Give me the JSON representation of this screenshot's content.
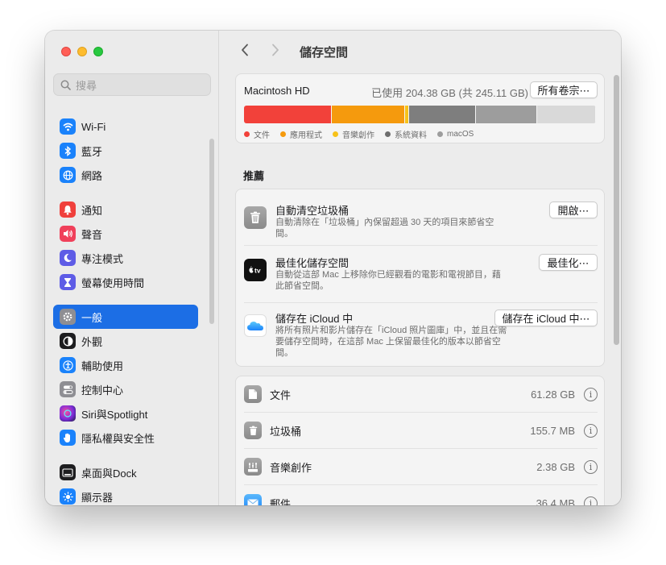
{
  "window": {
    "title": "儲存空間"
  },
  "search": {
    "placeholder": "搜尋"
  },
  "sidebar": {
    "items": [
      {
        "label": "Wi-Fi",
        "icon": "wifi-icon",
        "color": "#1a82fb"
      },
      {
        "label": "藍牙",
        "icon": "bluetooth-icon",
        "color": "#1a82fb"
      },
      {
        "label": "網路",
        "icon": "globe-icon",
        "color": "#1a82fb"
      },
      {
        "label": "通知",
        "icon": "bell-icon",
        "color": "#f0403c"
      },
      {
        "label": "聲音",
        "icon": "speaker-icon",
        "color": "#f0405a"
      },
      {
        "label": "專注模式",
        "icon": "moon-icon",
        "color": "#5e5ce6"
      },
      {
        "label": "螢幕使用時間",
        "icon": "hourglass-icon",
        "color": "#5e5ce6"
      },
      {
        "label": "一般",
        "icon": "gear-icon",
        "color": "#8e8e93",
        "selected": true
      },
      {
        "label": "外觀",
        "icon": "appearance-icon",
        "color": "#1d1d1f"
      },
      {
        "label": "輔助使用",
        "icon": "accessibility-icon",
        "color": "#1a82fb"
      },
      {
        "label": "控制中心",
        "icon": "toggles-icon",
        "color": "#8e8e93"
      },
      {
        "label": "Siri與Spotlight",
        "icon": "siri-icon",
        "color": "#8b3ad6"
      },
      {
        "label": "隱私權與安全性",
        "icon": "hand-icon",
        "color": "#1a82fb"
      },
      {
        "label": "桌面與Dock",
        "icon": "dock-icon",
        "color": "#1d1d1f"
      },
      {
        "label": "顯示器",
        "icon": "sun-icon",
        "color": "#1a82fb"
      }
    ]
  },
  "storage": {
    "disk_name": "Macintosh HD",
    "usage_text": "已使用 204.38 GB (共 245.11 GB)",
    "volumes_button": "所有卷宗⋯",
    "segments": [
      {
        "label": "文件",
        "fraction": 0.25,
        "color": "#f2413a"
      },
      {
        "label": "應用程式",
        "fraction": 0.208,
        "color": "#f59a0d"
      },
      {
        "label": "音樂創作",
        "fraction": 0.01,
        "color": "#f7c21a"
      },
      {
        "label": "系統資料",
        "fraction": 0.19,
        "color": "#7e7e7e"
      },
      {
        "label": "macOS",
        "fraction": 0.175,
        "color": "#9d9d9d"
      },
      {
        "label": "",
        "fraction": 0.167,
        "color": "#d9d9d9"
      }
    ],
    "legend": [
      {
        "label": "文件",
        "color": "#f2413a"
      },
      {
        "label": "應用程式",
        "color": "#f59a0d"
      },
      {
        "label": "音樂創作",
        "color": "#f7c21a"
      },
      {
        "label": "系統資料",
        "color": "#6e6e6e"
      },
      {
        "label": "macOS",
        "color": "#9d9d9d"
      }
    ]
  },
  "recommendations": {
    "title": "推薦",
    "items": [
      {
        "title": "自動清空垃圾桶",
        "desc": "自動清除在「垃圾桶」內保留超過 30 天的項目來節省空間。",
        "button": "開啟⋯",
        "icon": "trash-icon"
      },
      {
        "title": "最佳化儲存空間",
        "desc": "自動從這部 Mac 上移除你已經觀看的電影和電視節目，藉此節省空間。",
        "button": "最佳化⋯",
        "icon": "apple-tv-icon"
      },
      {
        "title": "儲存在 iCloud 中",
        "desc": "將所有照片和影片儲存在「iCloud 照片圖庫」中，並且在需要儲存空間時，在這部 Mac 上保留最佳化的版本以節省空間。",
        "button": "儲存在 iCloud 中⋯",
        "icon": "icloud-icon"
      }
    ]
  },
  "categories": [
    {
      "label": "文件",
      "size": "61.28 GB",
      "icon": "document-icon"
    },
    {
      "label": "垃圾桶",
      "size": "155.7 MB",
      "icon": "trash-icon"
    },
    {
      "label": "音樂創作",
      "size": "2.38 GB",
      "icon": "music-creation-icon"
    },
    {
      "label": "郵件",
      "size": "36.4 MB",
      "icon": "mail-icon"
    }
  ]
}
